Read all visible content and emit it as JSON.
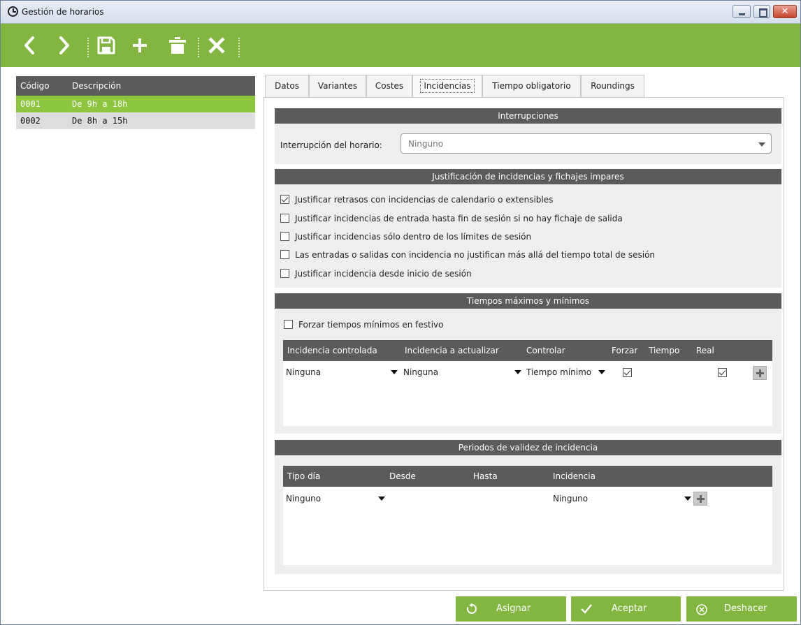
{
  "window": {
    "title": "Gestión de horarios"
  },
  "toolbar": {
    "icons": [
      "chevron-left-icon",
      "chevron-right-icon",
      "save-icon",
      "add-icon",
      "delete-icon",
      "close-icon"
    ]
  },
  "list": {
    "headers": {
      "code": "Código",
      "description": "Descripción"
    },
    "rows": [
      {
        "code": "0001",
        "description": "De 9h a 18h",
        "selected": true
      },
      {
        "code": "0002",
        "description": "De 8h a 15h",
        "selected": false
      }
    ]
  },
  "tabs": [
    "Datos",
    "Variantes",
    "Costes",
    "Incidencias",
    "Tiempo obligatorio",
    "Roundings"
  ],
  "active_tab": "Incidencias",
  "interrupciones": {
    "title": "Interrupciones",
    "label": "Interrupción del horario:",
    "value": "Ninguno"
  },
  "justificacion": {
    "title": "Justificación de incidencias y fichajes impares",
    "options": [
      {
        "label": "Justificar retrasos con incidencias de calendario o extensibles",
        "checked": true
      },
      {
        "label": "Justificar incidencias de entrada hasta fin de sesión si no hay fichaje de salida",
        "checked": false
      },
      {
        "label": "Justificar incidencias sólo dentro de los límites de sesión",
        "checked": false
      },
      {
        "label": "Las entradas o salidas con incidencia no justifican más allá del tiempo total de sesión",
        "checked": false
      },
      {
        "label": "Justificar incidencia desde inicio de sesión",
        "checked": false
      }
    ]
  },
  "tiempos": {
    "title": "Tiempos máximos y mínimos",
    "force_label": "Forzar tiempos mínimos en festivo",
    "force_checked": false,
    "columns": [
      "Incidencia controlada",
      "Incidencia a actualizar",
      "Controlar",
      "Forzar",
      "Tiempo",
      "Real"
    ],
    "row": {
      "incidencia_controlada": "Ninguna",
      "incidencia_actualizar": "Ninguna",
      "controlar": "Tiempo mínimo",
      "forzar": true,
      "real": true
    }
  },
  "periodos": {
    "title": "Periodos de validez de incidencia",
    "columns": [
      "Tipo día",
      "Desde",
      "Hasta",
      "Incidencia"
    ],
    "row": {
      "tipo_dia": "Ninguno",
      "incidencia": "Ninguno"
    }
  },
  "actions": {
    "assign": "Asignar",
    "accept": "Aceptar",
    "undo": "Deshacer"
  },
  "colors": {
    "brand_green": "#82b640",
    "selected_row": "#8dc53e",
    "header_gray": "#5b5b5b"
  }
}
